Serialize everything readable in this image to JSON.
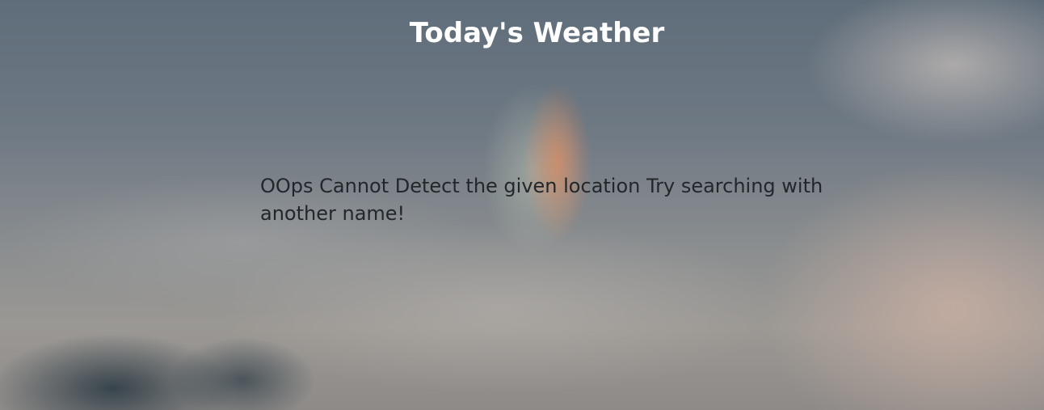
{
  "page": {
    "title": "Today's Weather"
  },
  "error": {
    "message": "OOps Cannot Detect the given location Try searching with another name!"
  },
  "colors": {
    "title_text": "#ffffff",
    "message_text": "#23272b"
  }
}
